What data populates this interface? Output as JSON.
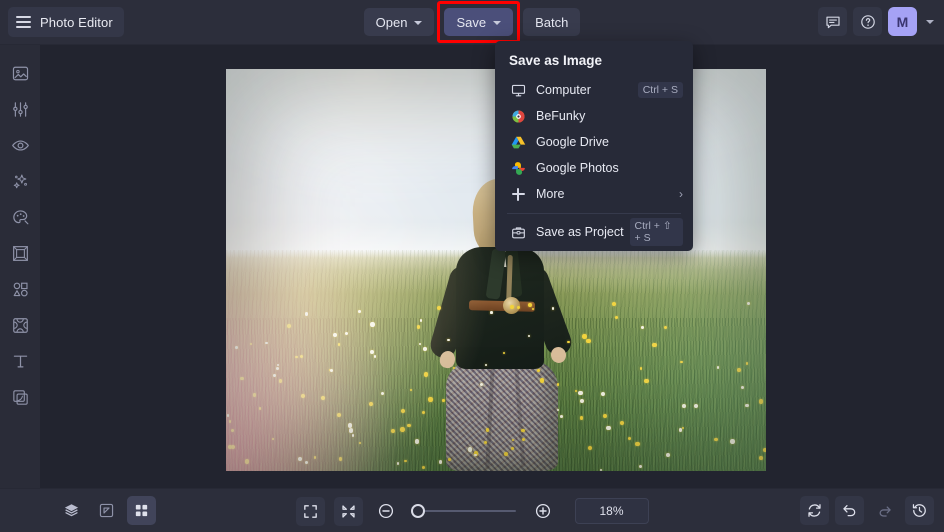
{
  "app": {
    "title": "Photo Editor",
    "menu_icon": "hamburger-icon"
  },
  "header": {
    "open_label": "Open",
    "save_label": "Save",
    "batch_label": "Batch",
    "feedback_icon": "feedback-icon",
    "help_icon": "help-icon",
    "avatar_initial": "M",
    "accent_active": "#4b4f7a",
    "avatar_color": "#a5a2f5",
    "highlight_color": "#ff0000"
  },
  "sidebar": {
    "items": [
      {
        "name": "sidebar-item-image",
        "icon": "image-icon"
      },
      {
        "name": "sidebar-item-edit",
        "icon": "sliders-icon"
      },
      {
        "name": "sidebar-item-touch-up",
        "icon": "eye-icon"
      },
      {
        "name": "sidebar-item-effects",
        "icon": "sparkles-icon"
      },
      {
        "name": "sidebar-item-artsy",
        "icon": "palette-icon"
      },
      {
        "name": "sidebar-item-frames",
        "icon": "frame-icon"
      },
      {
        "name": "sidebar-item-graphics",
        "icon": "shapes-icon"
      },
      {
        "name": "sidebar-item-overlays",
        "icon": "mask-icon"
      },
      {
        "name": "sidebar-item-text",
        "icon": "text-icon"
      },
      {
        "name": "sidebar-item-textures",
        "icon": "layers-copy-icon"
      }
    ]
  },
  "save_menu": {
    "title": "Save as Image",
    "items": [
      {
        "label": "Computer",
        "shortcut": "Ctrl + S",
        "icon": "monitor-icon"
      },
      {
        "label": "BeFunky",
        "shortcut": "",
        "icon": "befunky-logo-icon"
      },
      {
        "label": "Google Drive",
        "shortcut": "",
        "icon": "google-drive-icon"
      },
      {
        "label": "Google Photos",
        "shortcut": "",
        "icon": "google-photos-icon"
      },
      {
        "label": "More",
        "shortcut": "",
        "icon": "plus-icon",
        "arrow": "›"
      }
    ],
    "project": {
      "label": "Save as Project",
      "shortcut": "Ctrl + ⇧ + S",
      "icon": "save-project-icon"
    }
  },
  "bottom_bar": {
    "left_tools": [
      {
        "name": "layers-button",
        "icon": "layers-icon",
        "active": false
      },
      {
        "name": "compare-button",
        "icon": "compare-icon",
        "active": false
      },
      {
        "name": "grid-button",
        "icon": "grid-icon",
        "active": true
      }
    ],
    "fit_icon": "fit-screen-icon",
    "shrink_icon": "shrink-icon",
    "zoom_out_icon": "zoom-out-icon",
    "zoom_in_icon": "zoom-in-icon",
    "zoom_value": "18%",
    "zoom_slider_percent": 0,
    "right_tools": [
      {
        "name": "reset-button",
        "icon": "reset-icon"
      },
      {
        "name": "undo-button",
        "icon": "undo-icon"
      },
      {
        "name": "redo-button",
        "icon": "redo-icon"
      },
      {
        "name": "history-button",
        "icon": "history-icon"
      }
    ]
  },
  "canvas": {
    "image_alt": "woman-in-field-photo",
    "zoom": "18%"
  }
}
